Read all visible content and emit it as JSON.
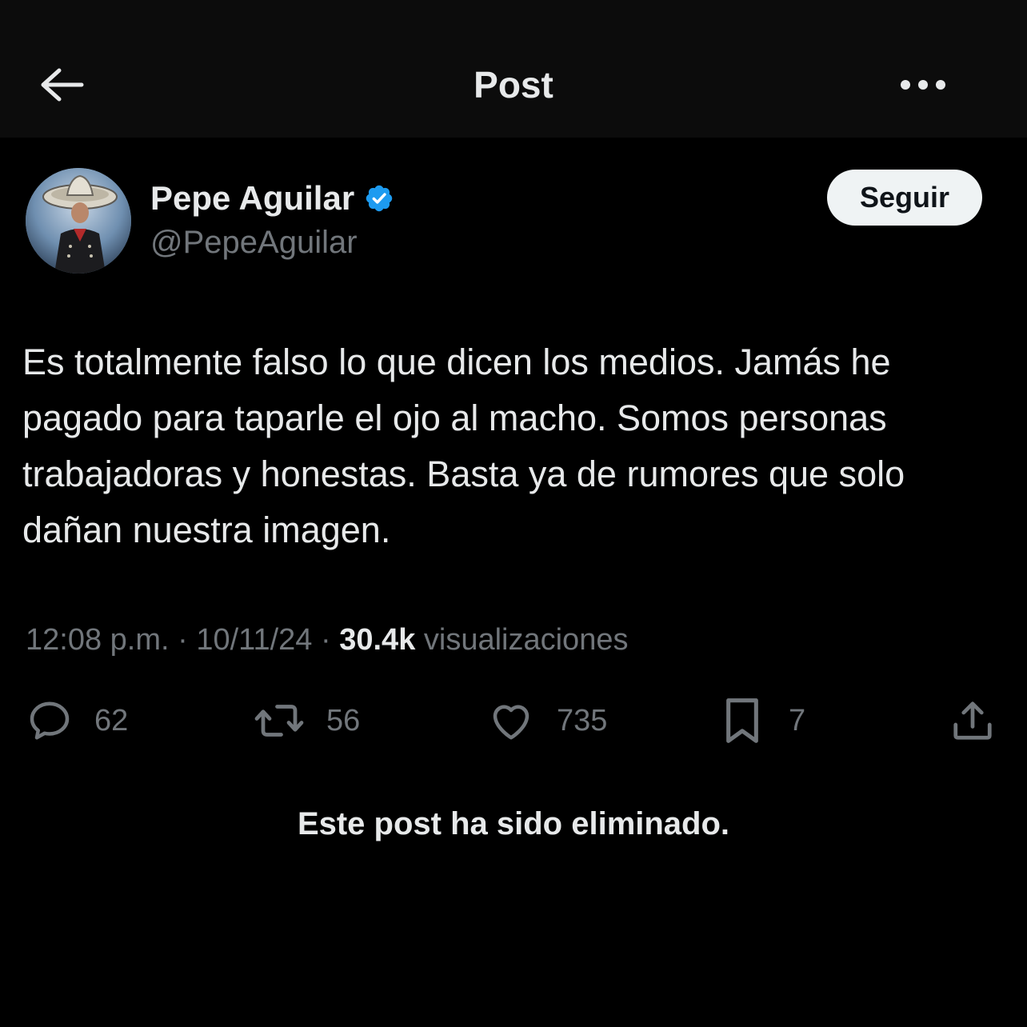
{
  "header": {
    "title": "Post",
    "back_icon": "arrow-left-icon",
    "more_icon": "more-horizontal-icon"
  },
  "author": {
    "name": "Pepe Aguilar",
    "handle": "@PepeAguilar",
    "verified": true,
    "verified_color": "#1d9bf0"
  },
  "follow_button": {
    "label": "Seguir"
  },
  "post": {
    "text": "Es totalmente falso lo que dicen los medios. Jamás he pagado para taparle el ojo al macho. Somos personas trabajadoras y honestas. Basta ya de rumores que solo dañan nuestra imagen.",
    "time": "12:08 p.m.",
    "separator": "·",
    "date": "10/11/24",
    "views_count": "30.4k",
    "views_label": "visualizaciones"
  },
  "actions": {
    "replies": {
      "icon": "reply-icon",
      "count": "62"
    },
    "reposts": {
      "icon": "repost-icon",
      "count": "56"
    },
    "likes": {
      "icon": "heart-icon",
      "count": "735"
    },
    "bookmarks": {
      "icon": "bookmark-icon",
      "count": "7"
    },
    "share": {
      "icon": "share-icon"
    }
  },
  "notice": "Este post ha sido eliminado.",
  "colors": {
    "background": "#000000",
    "header_background": "#0c0c0c",
    "primary_text": "#e7e9ea",
    "secondary_text": "#71767b",
    "accent": "#1d9bf0"
  }
}
